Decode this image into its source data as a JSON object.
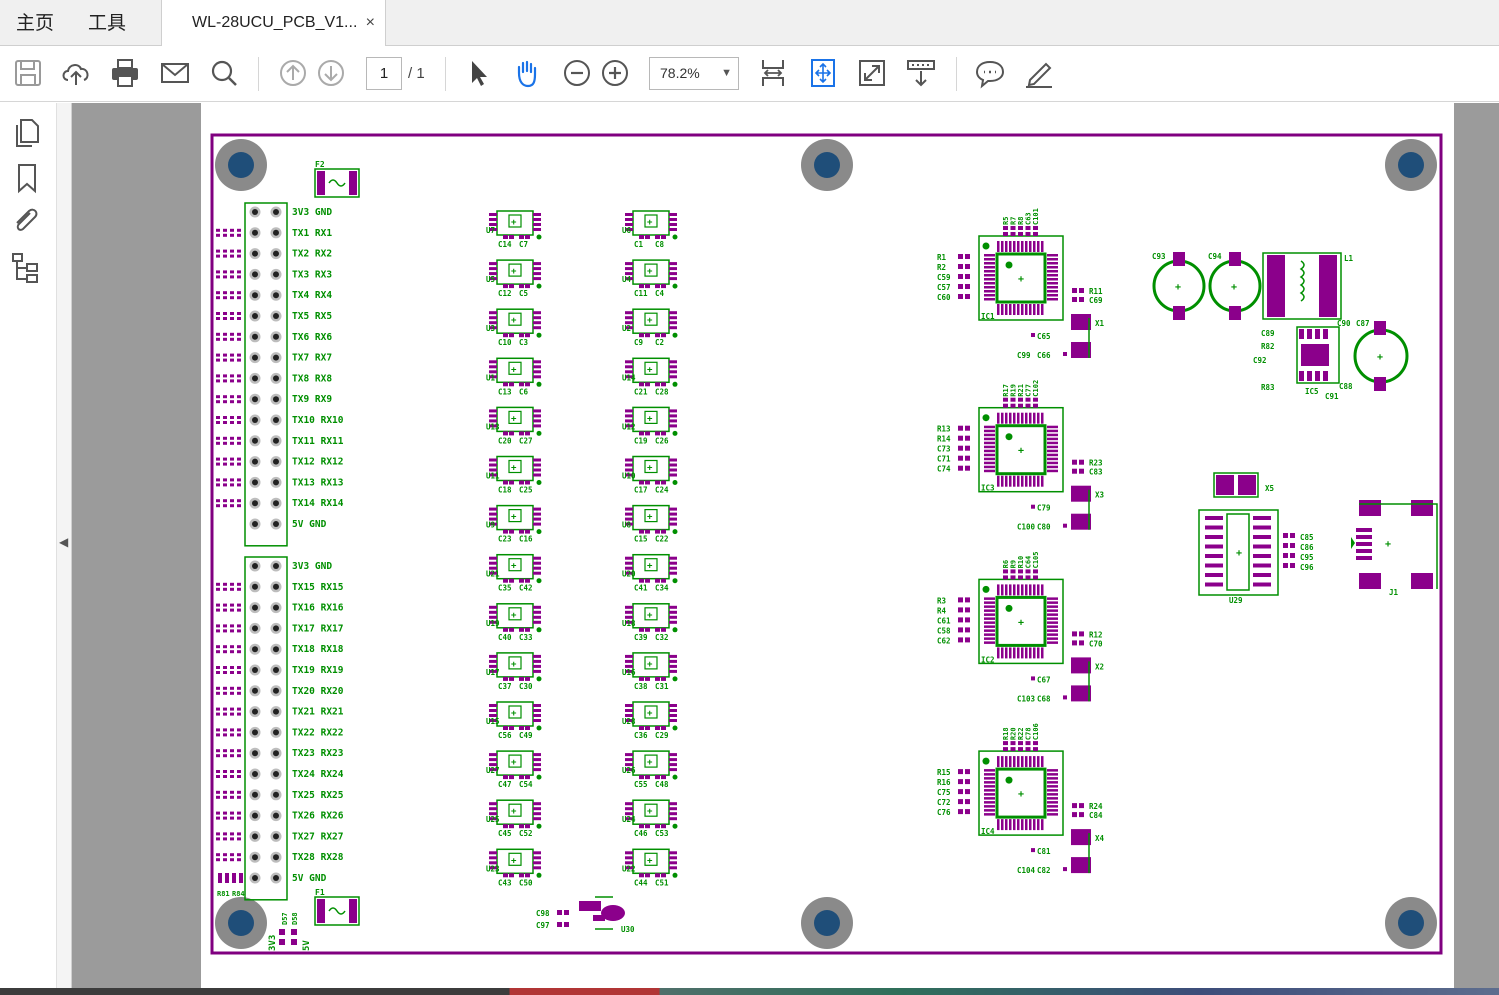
{
  "tabbar": {
    "home_label": "主页",
    "tools_label": "工具",
    "document_tab_label": "WL-28UCU_PCB_V1...",
    "close_glyph": "×"
  },
  "toolbar": {
    "icons": [
      "save-icon",
      "upload-icon",
      "print-icon",
      "email-icon",
      "search-icon",
      "previous-page-icon",
      "next-page-icon",
      "select-pointer-icon",
      "hand-tool-icon",
      "zoom-out-icon",
      "zoom-in-icon",
      "fit-width-icon",
      "fit-page-icon",
      "fullscreen-icon",
      "scroll-mode-icon",
      "comment-icon",
      "highlight-pen-icon"
    ],
    "page_current": "1",
    "page_total": "/ 1",
    "zoom": "78.2%"
  },
  "sidepanel": {
    "icons": [
      "copy-pages-icon",
      "bookmark-icon",
      "attachment-icon",
      "structure-tree-icon"
    ],
    "collapse_glyph": "◀"
  },
  "colors": {
    "board_outline": "#800080",
    "pad": "#8b008b",
    "silkscreen": "#008f00",
    "mount_hole_ring": "#8a8a8a",
    "mount_hole_core": "#1f4e79",
    "accent_blue": "#1a73e8"
  },
  "pcb": {
    "header_top_labels": [
      "3V3 GND",
      "TX1 RX1",
      "TX2 RX2",
      "TX3 RX3",
      "TX4 RX4",
      "TX5 RX5",
      "TX6 RX6",
      "TX7 RX7",
      "TX8 RX8",
      "TX9 RX9",
      "TX10 RX10",
      "TX11 RX11",
      "TX12 RX12",
      "TX13 RX13",
      "TX14 RX14",
      "5V GND"
    ],
    "header_bottom_labels": [
      "3V3 GND",
      "TX15 RX15",
      "TX16 RX16",
      "TX17 RX17",
      "TX18 RX18",
      "TX19 RX19",
      "TX20 RX20",
      "TX21 RX21",
      "TX22 RX22",
      "TX23 RX23",
      "TX24 RX24",
      "TX25 RX25",
      "TX26 RX26",
      "TX27 RX27",
      "TX28 RX28",
      "5V GND"
    ],
    "fuse_labels": [
      "F2",
      "F1"
    ],
    "bottom_left_labels": [
      "R81",
      "R84",
      "D57",
      "D58",
      "3V3",
      "5V"
    ],
    "column1": [
      {
        "u": "U7",
        "c1": "C14",
        "c2": "C7"
      },
      {
        "u": "U5",
        "c1": "C12",
        "c2": "C5"
      },
      {
        "u": "U3",
        "c1": "C10",
        "c2": "C3"
      },
      {
        "u": "U1",
        "c1": "C13",
        "c2": "C6"
      },
      {
        "u": "U13",
        "c1": "C20",
        "c2": "C27"
      },
      {
        "u": "U11",
        "c1": "C18",
        "c2": "C25"
      },
      {
        "u": "U9",
        "c1": "C23",
        "c2": "C16"
      },
      {
        "u": "U21",
        "c1": "C35",
        "c2": "C42"
      },
      {
        "u": "U19",
        "c1": "C40",
        "c2": "C33"
      },
      {
        "u": "U17",
        "c1": "C37",
        "c2": "C30"
      },
      {
        "u": "U15",
        "c1": "C56",
        "c2": "C49"
      },
      {
        "u": "U27",
        "c1": "C47",
        "c2": "C54"
      },
      {
        "u": "U25",
        "c1": "C45",
        "c2": "C52"
      },
      {
        "u": "U23",
        "c1": "C43",
        "c2": "C50"
      }
    ],
    "column2": [
      {
        "u": "U6",
        "c1": "C1",
        "c2": "C8"
      },
      {
        "u": "U4",
        "c1": "C11",
        "c2": "C4"
      },
      {
        "u": "U2",
        "c1": "C9",
        "c2": "C2"
      },
      {
        "u": "U14",
        "c1": "C21",
        "c2": "C28"
      },
      {
        "u": "U12",
        "c1": "C19",
        "c2": "C26"
      },
      {
        "u": "U10",
        "c1": "C17",
        "c2": "C24"
      },
      {
        "u": "U8",
        "c1": "C15",
        "c2": "C22"
      },
      {
        "u": "U20",
        "c1": "C41",
        "c2": "C34"
      },
      {
        "u": "U18",
        "c1": "C39",
        "c2": "C32"
      },
      {
        "u": "U16",
        "c1": "C38",
        "c2": "C31"
      },
      {
        "u": "U28",
        "c1": "C36",
        "c2": "C29"
      },
      {
        "u": "U26",
        "c1": "C55",
        "c2": "C48"
      },
      {
        "u": "U24",
        "c1": "C46",
        "c2": "C53"
      },
      {
        "u": "U22",
        "c1": "C44",
        "c2": "C51"
      }
    ],
    "u30_labels": [
      "C98",
      "C97",
      "U30"
    ],
    "ic_blocks": [
      {
        "ic": "IC1",
        "xtal": "X1",
        "top": [
          "R5",
          "R7",
          "R8",
          "C63",
          "C101"
        ],
        "left": [
          "R1",
          "R2",
          "C59",
          "C57",
          "C60"
        ],
        "right": [
          "R11",
          "C69"
        ],
        "bottom": [
          "C65",
          "C99",
          "C66"
        ]
      },
      {
        "ic": "IC3",
        "xtal": "X3",
        "top": [
          "R17",
          "R19",
          "R21",
          "C77",
          "C102"
        ],
        "left": [
          "R13",
          "R14",
          "C73",
          "C71",
          "C74"
        ],
        "right": [
          "R23",
          "C83"
        ],
        "bottom": [
          "C79",
          "C100",
          "C80"
        ]
      },
      {
        "ic": "IC2",
        "xtal": "X2",
        "top": [
          "R6",
          "R9",
          "R10",
          "C64",
          "C105"
        ],
        "left": [
          "R3",
          "R4",
          "C61",
          "C58",
          "C62"
        ],
        "right": [
          "R12",
          "C70"
        ],
        "bottom": [
          "C67",
          "C103",
          "C68"
        ]
      },
      {
        "ic": "IC4",
        "xtal": "X4",
        "top": [
          "R18",
          "R20",
          "R22",
          "C78",
          "C106"
        ],
        "left": [
          "R15",
          "R16",
          "C75",
          "C72",
          "C76"
        ],
        "right": [
          "R24",
          "C84"
        ],
        "bottom": [
          "C81",
          "C104",
          "C82"
        ]
      }
    ],
    "power_labels": [
      "C93",
      "C94",
      "L1",
      "C89",
      "R82",
      "C92",
      "R83",
      "IC5",
      "C91",
      "C90",
      "C87",
      "C88"
    ],
    "right_labels": [
      "X5",
      "U29",
      "C85",
      "C86",
      "C95",
      "C96",
      "J1"
    ]
  }
}
